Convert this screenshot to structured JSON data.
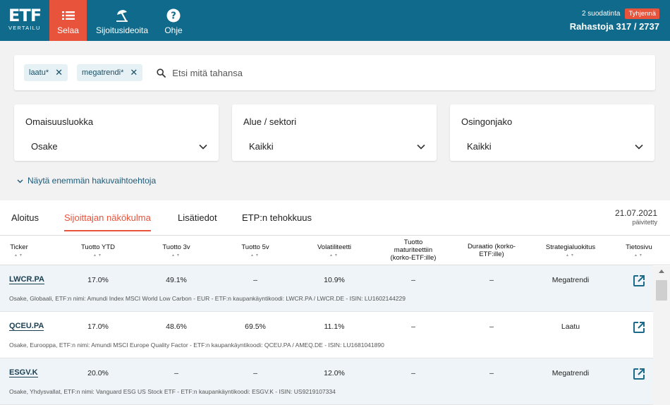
{
  "header": {
    "logo_main": "ETF",
    "logo_sub": "VERTAILU",
    "nav": [
      {
        "label": "Selaa",
        "icon": "list-icon",
        "active": true
      },
      {
        "label": "Sijoitusideoita",
        "icon": "umbrella-icon",
        "active": false
      },
      {
        "label": "Ohje",
        "icon": "help-icon",
        "active": false
      }
    ],
    "filter_count": "2 suodatinta",
    "clear_label": "Tyhjennä",
    "fund_count": "Rahastoja 317 / 2737"
  },
  "search": {
    "chips": [
      "laatu*",
      "megatrendi*"
    ],
    "placeholder": "Etsi mitä tahansa"
  },
  "selects": [
    {
      "label": "Omaisuusluokka",
      "value": "Osake"
    },
    {
      "label": "Alue / sektori",
      "value": "Kaikki"
    },
    {
      "label": "Osingonjako",
      "value": "Kaikki"
    }
  ],
  "more_options": "Näytä enemmän hakuvaihtoehtoja",
  "tabs": [
    "Aloitus",
    "Sijoittajan näkökulma",
    "Lisätiedot",
    "ETP:n tehokkuus"
  ],
  "active_tab": 1,
  "date": {
    "value": "21.07.2021",
    "note": "päivitetty"
  },
  "columns": {
    "ticker": "Ticker",
    "ytd": "Tuotto YTD",
    "r3": "Tuotto 3v",
    "r5": "Tuotto 5v",
    "vol": "Volatiliteetti",
    "mat1": "Tuotto",
    "mat2": "maturiteettiin",
    "mat3": "(korko-ETF:ille)",
    "dur1": "Duraatio (korko-",
    "dur2": "ETF:ille)",
    "strat": "Strategialuokitus",
    "info": "Tietosivu"
  },
  "rows": [
    {
      "ticker": "LWCR.PA",
      "ytd": "17.0%",
      "r3": "49.1%",
      "r5": "–",
      "vol": "10.9%",
      "mat": "–",
      "dur": "–",
      "strat": "Megatrendi",
      "desc": "Osake, Globaali, ETF:n nimi: Amundi Index MSCI World Low Carbon - EUR - ETF:n kaupankäyntikoodi: LWCR.PA / LWCR.DE - ISIN: LU1602144229"
    },
    {
      "ticker": "QCEU.PA",
      "ytd": "17.0%",
      "r3": "48.6%",
      "r5": "69.5%",
      "vol": "11.1%",
      "mat": "–",
      "dur": "–",
      "strat": "Laatu",
      "desc": "Osake, Eurooppa, ETF:n nimi: Amundi MSCI Europe Quality Factor - ETF:n kaupankäyntikoodi: QCEU.PA / AMEQ.DE - ISIN: LU1681041890"
    },
    {
      "ticker": "ESGV.K",
      "ytd": "20.0%",
      "r3": "–",
      "r5": "–",
      "vol": "12.0%",
      "mat": "–",
      "dur": "–",
      "strat": "Megatrendi",
      "desc": "Osake, Yhdysvallat, ETF:n nimi: Vanguard ESG US Stock ETF - ETF:n kaupankäyntikoodi: ESGV.K - ISIN: US9219107334"
    }
  ],
  "colors": {
    "header": "#0f6a8b",
    "accent": "#e8533c",
    "link": "#1c5a78"
  }
}
